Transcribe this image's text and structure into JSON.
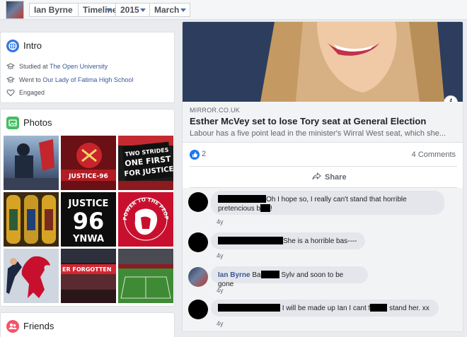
{
  "topbar": {
    "name": "Ian Byrne",
    "view": "Timeline",
    "year": "2015",
    "month": "March"
  },
  "intro": {
    "title": "Intro",
    "studied_prefix": "Studied at ",
    "studied_place": "The Open University",
    "went_prefix": "Went to ",
    "went_place": "Our Lady of Fatima High School",
    "relationship": "Engaged"
  },
  "photos": {
    "title": "Photos",
    "tiles": [
      {
        "name": "Photo of crowd with flags"
      },
      {
        "name": "Photo of Justice 96 banner"
      },
      {
        "name": "Photo of One First for Justice banner"
      },
      {
        "name": "Photo of stained glass windows"
      },
      {
        "name": "Photo of Justice 96 YNWA"
      },
      {
        "name": "Photo of Power to the People"
      },
      {
        "name": "Photo of Liverpool liver bird artwork"
      },
      {
        "name": "Photo of stadium at night"
      },
      {
        "name": "Photo of football pitch"
      }
    ],
    "tile_texts": {
      "justice96_banner": "JUSTICE-96",
      "banner_line1": "TWO STRIDES",
      "banner_line2": "ONE FIRST",
      "banner_line3": "FOR JUSTICE",
      "justice": "JUSTICE",
      "ninety_six": "96",
      "ynwa": "YNWA",
      "power_to_the_people": "POWER TO THE PEOPLE",
      "forgotten": "ER FORGOTTEN"
    }
  },
  "friends": {
    "title": "Friends"
  },
  "post": {
    "link_domain": "MIRROR.CO.UK",
    "link_title": "Esther McVey set to lose Tory seat at General Election",
    "link_desc": "Labour has a five point lead in the minister's Wirral West seat, which she...",
    "like_count": "2",
    "comment_count": "4 Comments",
    "share_label": "Share"
  },
  "comments": [
    {
      "text_a": "Oh I hope so, I really can't stand that horrible",
      "text_b": "pretencious b",
      "text_c": "!",
      "time": "4y"
    },
    {
      "text_a": "She is a horrible bas----",
      "time": "4y"
    },
    {
      "name": "Ian Byrne",
      "text_a": "Ba",
      "text_b": " Sylv and soon to be gone",
      "time": "4y"
    },
    {
      "text_a": "I will be made up Ian I cant f",
      "text_b": " stand her. xx",
      "time": "4y"
    }
  ],
  "colors": {
    "accent": "#385898",
    "like_blue": "#1877f2",
    "page_bg": "#e9ebee"
  }
}
